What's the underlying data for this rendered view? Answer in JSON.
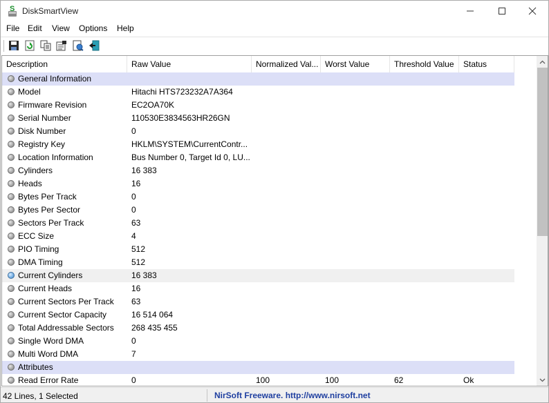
{
  "window": {
    "title": "DiskSmartView",
    "icon": "disksmartview-app-icon"
  },
  "menu": [
    "File",
    "Edit",
    "View",
    "Options",
    "Help"
  ],
  "toolbar": {
    "buttons": [
      "save-icon",
      "refresh-icon",
      "copy-icon",
      "properties-icon",
      "html-report-icon",
      "exit-icon"
    ]
  },
  "table": {
    "columns": [
      "Description",
      "Raw Value",
      "Normalized Val...",
      "Worst Value",
      "Threshold Value",
      "Status"
    ],
    "rows": [
      {
        "type": "group",
        "description": "General Information",
        "raw": "",
        "normalized": "",
        "worst": "",
        "threshold": "",
        "status": ""
      },
      {
        "type": "item",
        "description": "Model",
        "raw": "Hitachi HTS723232A7A364",
        "normalized": "",
        "worst": "",
        "threshold": "",
        "status": ""
      },
      {
        "type": "item",
        "description": "Firmware Revision",
        "raw": "EC2OA70K",
        "normalized": "",
        "worst": "",
        "threshold": "",
        "status": ""
      },
      {
        "type": "item",
        "description": "Serial Number",
        "raw": "110530E3834563HR26GN",
        "normalized": "",
        "worst": "",
        "threshold": "",
        "status": ""
      },
      {
        "type": "item",
        "description": "Disk Number",
        "raw": "0",
        "normalized": "",
        "worst": "",
        "threshold": "",
        "status": ""
      },
      {
        "type": "item",
        "description": "Registry Key",
        "raw": "HKLM\\SYSTEM\\CurrentContr...",
        "normalized": "",
        "worst": "",
        "threshold": "",
        "status": ""
      },
      {
        "type": "item",
        "description": "Location Information",
        "raw": "Bus Number 0, Target Id 0, LU...",
        "normalized": "",
        "worst": "",
        "threshold": "",
        "status": ""
      },
      {
        "type": "item",
        "description": "Cylinders",
        "raw": "16 383",
        "normalized": "",
        "worst": "",
        "threshold": "",
        "status": ""
      },
      {
        "type": "item",
        "description": "Heads",
        "raw": "16",
        "normalized": "",
        "worst": "",
        "threshold": "",
        "status": ""
      },
      {
        "type": "item",
        "description": "Bytes Per Track",
        "raw": "0",
        "normalized": "",
        "worst": "",
        "threshold": "",
        "status": ""
      },
      {
        "type": "item",
        "description": "Bytes Per Sector",
        "raw": "0",
        "normalized": "",
        "worst": "",
        "threshold": "",
        "status": ""
      },
      {
        "type": "item",
        "description": "Sectors Per Track",
        "raw": "63",
        "normalized": "",
        "worst": "",
        "threshold": "",
        "status": ""
      },
      {
        "type": "item",
        "description": "ECC Size",
        "raw": "4",
        "normalized": "",
        "worst": "",
        "threshold": "",
        "status": ""
      },
      {
        "type": "item",
        "description": "PIO Timing",
        "raw": "512",
        "normalized": "",
        "worst": "",
        "threshold": "",
        "status": ""
      },
      {
        "type": "item",
        "description": "DMA Timing",
        "raw": "512",
        "normalized": "",
        "worst": "",
        "threshold": "",
        "status": ""
      },
      {
        "type": "item",
        "selected": true,
        "description": "Current Cylinders",
        "raw": "16 383",
        "normalized": "",
        "worst": "",
        "threshold": "",
        "status": ""
      },
      {
        "type": "item",
        "description": "Current Heads",
        "raw": "16",
        "normalized": "",
        "worst": "",
        "threshold": "",
        "status": ""
      },
      {
        "type": "item",
        "description": "Current Sectors Per Track",
        "raw": "63",
        "normalized": "",
        "worst": "",
        "threshold": "",
        "status": ""
      },
      {
        "type": "item",
        "description": "Current Sector Capacity",
        "raw": "16 514 064",
        "normalized": "",
        "worst": "",
        "threshold": "",
        "status": ""
      },
      {
        "type": "item",
        "description": "Total Addressable Sectors",
        "raw": "268 435 455",
        "normalized": "",
        "worst": "",
        "threshold": "",
        "status": ""
      },
      {
        "type": "item",
        "description": "Single Word DMA",
        "raw": "0",
        "normalized": "",
        "worst": "",
        "threshold": "",
        "status": ""
      },
      {
        "type": "item",
        "description": "Multi Word DMA",
        "raw": "7",
        "normalized": "",
        "worst": "",
        "threshold": "",
        "status": ""
      },
      {
        "type": "group",
        "description": "Attributes",
        "raw": "",
        "normalized": "",
        "worst": "",
        "threshold": "",
        "status": ""
      },
      {
        "type": "item",
        "description": "Read Error Rate",
        "raw": "0",
        "normalized": "100",
        "worst": "100",
        "threshold": "62",
        "status": "Ok"
      }
    ]
  },
  "statusbar": {
    "left": "42 Lines, 1 Selected",
    "right": "NirSoft Freeware.  http://www.nirsoft.net"
  },
  "colors": {
    "group_row_bg": "#dcdff7",
    "selected_row_bg": "#f0f0f0",
    "status_link": "#1f3fa0"
  }
}
